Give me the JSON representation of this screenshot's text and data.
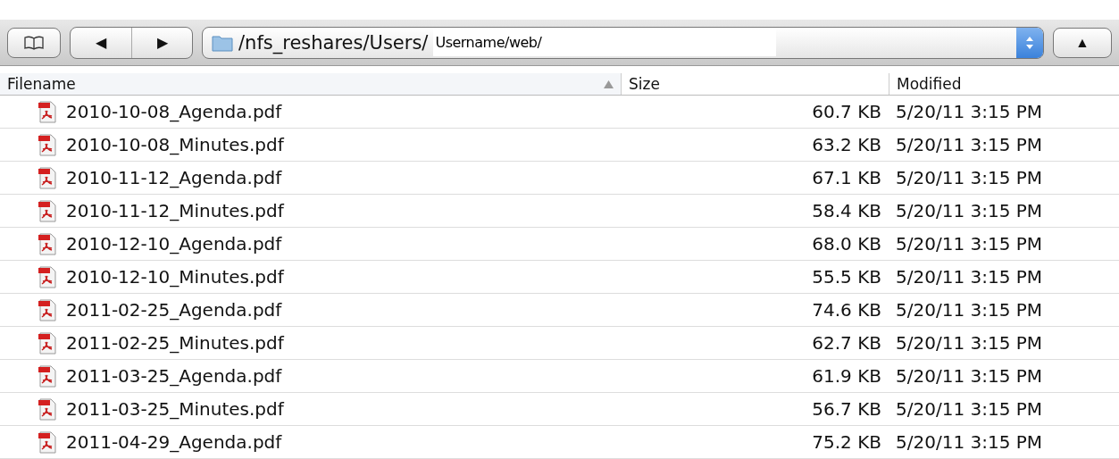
{
  "toolbar": {
    "back": "◀",
    "forward": "▶",
    "up": "▲",
    "path_prefix": "/nfs_reshares/Users/",
    "path_value": "Username/web/"
  },
  "table": {
    "columns": [
      {
        "label": "Filename",
        "sorted": true
      },
      {
        "label": "Size",
        "sorted": false
      },
      {
        "label": "Modified",
        "sorted": false
      }
    ],
    "rows": [
      {
        "name": "2010-10-08_Agenda.pdf",
        "size": "60.7 KB",
        "modified": "5/20/11 3:15 PM"
      },
      {
        "name": "2010-10-08_Minutes.pdf",
        "size": "63.2 KB",
        "modified": "5/20/11 3:15 PM"
      },
      {
        "name": "2010-11-12_Agenda.pdf",
        "size": "67.1 KB",
        "modified": "5/20/11 3:15 PM"
      },
      {
        "name": "2010-11-12_Minutes.pdf",
        "size": "58.4 KB",
        "modified": "5/20/11 3:15 PM"
      },
      {
        "name": "2010-12-10_Agenda.pdf",
        "size": "68.0 KB",
        "modified": "5/20/11 3:15 PM"
      },
      {
        "name": "2010-12-10_Minutes.pdf",
        "size": "55.5 KB",
        "modified": "5/20/11 3:15 PM"
      },
      {
        "name": "2011-02-25_Agenda.pdf",
        "size": "74.6 KB",
        "modified": "5/20/11 3:15 PM"
      },
      {
        "name": "2011-02-25_Minutes.pdf",
        "size": "62.7 KB",
        "modified": "5/20/11 3:15 PM"
      },
      {
        "name": "2011-03-25_Agenda.pdf",
        "size": "61.9 KB",
        "modified": "5/20/11 3:15 PM"
      },
      {
        "name": "2011-03-25_Minutes.pdf",
        "size": "56.7 KB",
        "modified": "5/20/11 3:15 PM"
      },
      {
        "name": "2011-04-29_Agenda.pdf",
        "size": "75.2 KB",
        "modified": "5/20/11 3:15 PM"
      }
    ]
  }
}
